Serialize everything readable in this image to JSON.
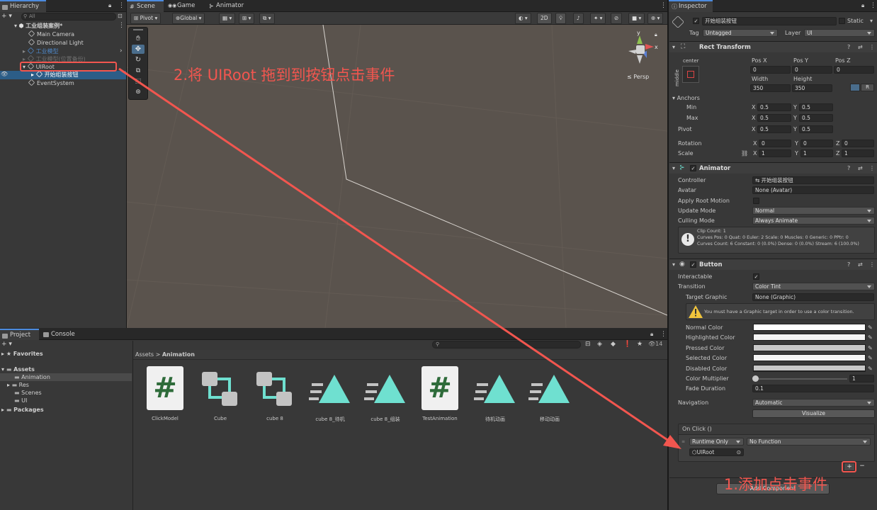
{
  "hierarchy": {
    "tab": "Hierarchy",
    "add_label": "+ ▾",
    "search_placeholder": "All",
    "scene": "工业组装案例*",
    "items": [
      {
        "label": "Main Camera"
      },
      {
        "label": "Directional Light"
      },
      {
        "label": "工业模型"
      },
      {
        "label": "工业模型(位置备份)"
      },
      {
        "label": "UIRoot"
      },
      {
        "label": "开始组装按钮"
      },
      {
        "label": "EventSystem"
      }
    ]
  },
  "scene_view": {
    "tabs": [
      "Scene",
      "Game",
      "Animator"
    ],
    "pivot": "Pivot",
    "global": "Global",
    "mode_2d": "2D",
    "persp": "≤ Persp",
    "gizmo_y": "y",
    "gizmo_x": "x"
  },
  "project": {
    "tabs": [
      "Project",
      "Console"
    ],
    "add_label": "+ ▾",
    "count": "14",
    "favorites": "Favorites",
    "assets": "Assets",
    "folders": [
      "Animation",
      "Res",
      "Scenes",
      "UI"
    ],
    "packages": "Packages",
    "breadcrumb_root": "Assets",
    "breadcrumb_sep": ">",
    "breadcrumb_current": "Animation",
    "files": [
      {
        "name": "ClickModel",
        "icon": "script-icon"
      },
      {
        "name": "Cube",
        "icon": "animator-controller-icon"
      },
      {
        "name": "cube 8",
        "icon": "animator-controller-icon"
      },
      {
        "name": "cube 8_待机",
        "icon": "animation-clip-icon"
      },
      {
        "name": "cube 8_组装",
        "icon": "animation-clip-icon"
      },
      {
        "name": "TestAnimation",
        "icon": "script-icon"
      },
      {
        "name": "待机动画",
        "icon": "animation-clip-icon"
      },
      {
        "name": "移动动画",
        "icon": "animation-clip-icon"
      }
    ]
  },
  "inspector": {
    "tab": "Inspector",
    "object_name": "开始组装按钮",
    "static_label": "Static",
    "tag_label": "Tag",
    "tag_value": "Untagged",
    "layer_label": "Layer",
    "layer_value": "UI",
    "rect_transform": {
      "title": "Rect Transform",
      "anchor_h": "center",
      "anchor_v": "middle",
      "posx_label": "Pos X",
      "posy_label": "Pos Y",
      "posz_label": "Pos Z",
      "posx": "0",
      "posy": "0",
      "posz": "0",
      "width_label": "Width",
      "height_label": "Height",
      "width": "350",
      "height": "350",
      "r_label": "R",
      "anchors_label": "Anchors",
      "min_label": "Min",
      "max_label": "Max",
      "min_x": "0.5",
      "min_y": "0.5",
      "max_x": "0.5",
      "max_y": "0.5",
      "pivot_label": "Pivot",
      "pivot_x": "0.5",
      "pivot_y": "0.5",
      "rotation_label": "Rotation",
      "rot_x": "0",
      "rot_y": "0",
      "rot_z": "0",
      "scale_label": "Scale",
      "scale_x": "1",
      "scale_y": "1",
      "scale_z": "1",
      "x": "X",
      "y": "Y",
      "z": "Z"
    },
    "animator": {
      "title": "Animator",
      "controller_label": "Controller",
      "controller_value": "开始组装按钮",
      "avatar_label": "Avatar",
      "avatar_value": "None (Avatar)",
      "root_motion_label": "Apply Root Motion",
      "update_mode_label": "Update Mode",
      "update_mode_value": "Normal",
      "culling_label": "Culling Mode",
      "culling_value": "Always Animate",
      "info_1": "Clip Count: 1",
      "info_2": "Curves Pos: 0 Quat: 0 Euler: 2 Scale: 0 Muscles: 0 Generic: 0 PPtr: 0",
      "info_3": "Curves Count: 6 Constant: 0 (0.0%) Dense: 0 (0.0%) Stream: 6 (100.0%)"
    },
    "button": {
      "title": "Button",
      "interactable_label": "Interactable",
      "transition_label": "Transition",
      "transition_value": "Color Tint",
      "target_graphic_label": "Target Graphic",
      "target_graphic_value": "None (Graphic)",
      "warning": "You must have a Graphic target in order to use a color transition.",
      "normal_color": "Normal Color",
      "highlighted_color": "Highlighted Color",
      "pressed_color": "Pressed Color",
      "selected_color": "Selected Color",
      "disabled_color": "Disabled Color",
      "color_multiplier_label": "Color Multiplier",
      "color_multiplier_value": "1",
      "fade_label": "Fade Duration",
      "fade_value": "0.1",
      "navigation_label": "Navigation",
      "navigation_value": "Automatic",
      "visualize_label": "Visualize",
      "onclick_label": "On Click ()",
      "runtime_value": "Runtime Only",
      "function_value": "No Function",
      "target_value": "UIRoot",
      "plus": "+",
      "minus": "−"
    },
    "add_component": "Add Component"
  },
  "annotations": {
    "step1": "1.添加点击事件",
    "step2": "2.将 UIRoot 拖到到按钮点击事件"
  },
  "colors": {
    "annotation_red": "#f2564f",
    "selection_blue": "#2c5d87",
    "scene_bg": "#5a534d",
    "panel_bg": "#383838",
    "tab_accent": "#4c8bde"
  }
}
